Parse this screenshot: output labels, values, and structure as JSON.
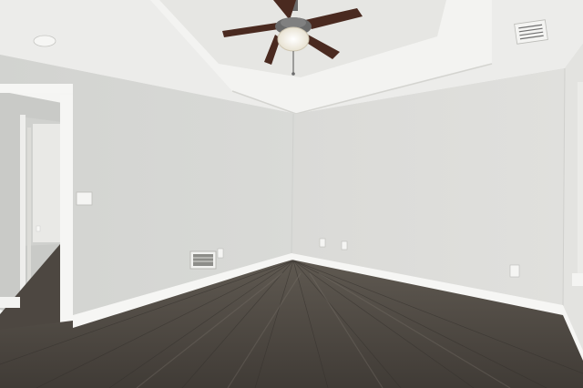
{
  "scene": {
    "kind": "empty-room-photo",
    "elements": [
      "tray-ceiling",
      "ceiling-fan",
      "smoke-detector",
      "air-vent",
      "doorway",
      "baseboard",
      "floor-vent",
      "wall-outlets",
      "light-switch",
      "wood-floor"
    ]
  },
  "palette": {
    "ceiling": "#ededeb",
    "tray": "#f4f4f2",
    "left_wall": "#d5d6d3",
    "back_wall": "#dcdcd9",
    "right_wall": "#e2e2df",
    "trim": "#f6f6f4",
    "floor_dark": "#3f3a35",
    "floor_mid": "#5a544d",
    "floor_light": "#6e6760",
    "fan_blade": "#4a2a20",
    "fan_metal": "#6b6b6b",
    "fan_light": "#f4eee0"
  }
}
